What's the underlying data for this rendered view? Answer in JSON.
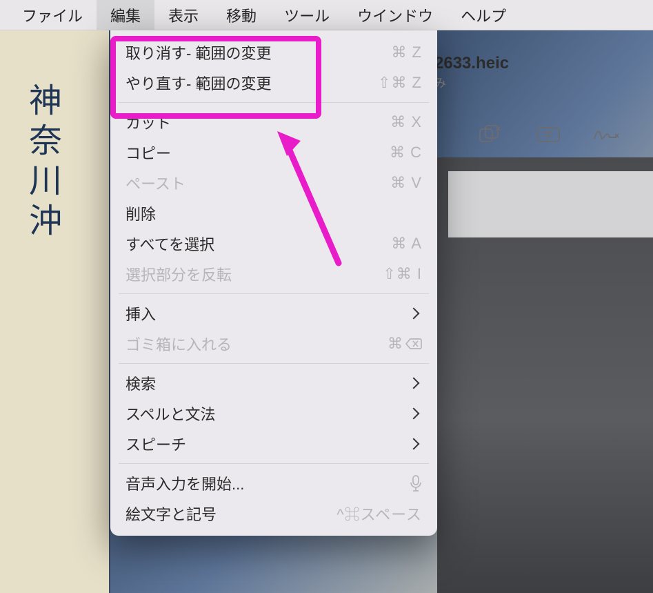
{
  "menubar": {
    "items": [
      "ファイル",
      "編集",
      "表示",
      "移動",
      "ツール",
      "ウインドウ",
      "ヘルプ"
    ],
    "active_index": 1
  },
  "window": {
    "title_tail": "2633.heic",
    "subtitle_tail": "み"
  },
  "toolbar_icons": [
    "overlap-squares-icon",
    "text-field-icon",
    "signature-icon"
  ],
  "edit_menu": {
    "groups": [
      [
        {
          "label": "取り消す- 範囲の変更",
          "shortcut": "⌘ Z",
          "disabled": false
        },
        {
          "label": "やり直す- 範囲の変更",
          "shortcut": "⇧⌘ Z",
          "disabled": false
        }
      ],
      [
        {
          "label": "カット",
          "shortcut": "⌘ X",
          "disabled": false
        },
        {
          "label": "コピー",
          "shortcut": "⌘ C",
          "disabled": false
        },
        {
          "label": "ペースト",
          "shortcut": "⌘ V",
          "disabled": true
        },
        {
          "label": "削除",
          "shortcut": "",
          "disabled": false
        },
        {
          "label": "すべてを選択",
          "shortcut": "⌘ A",
          "disabled": false
        },
        {
          "label": "選択部分を反転",
          "shortcut": "⇧⌘ I",
          "disabled": true
        }
      ],
      [
        {
          "label": "挿入",
          "shortcut": "",
          "submenu": true,
          "disabled": false
        },
        {
          "label": "ゴミ箱に入れる",
          "shortcut": "⌘ ⌫",
          "disabled": true
        }
      ],
      [
        {
          "label": "検索",
          "shortcut": "",
          "submenu": true,
          "disabled": false
        },
        {
          "label": "スペルと文法",
          "shortcut": "",
          "submenu": true,
          "disabled": false
        },
        {
          "label": "スピーチ",
          "shortcut": "",
          "submenu": true,
          "disabled": false
        }
      ],
      [
        {
          "label": "音声入力を開始...",
          "shortcut": "mic",
          "disabled": false
        },
        {
          "label": "絵文字と記号",
          "shortcut": "^⌘スペース",
          "disabled": false
        }
      ]
    ]
  },
  "background": {
    "vertical_text": "神奈川沖"
  }
}
